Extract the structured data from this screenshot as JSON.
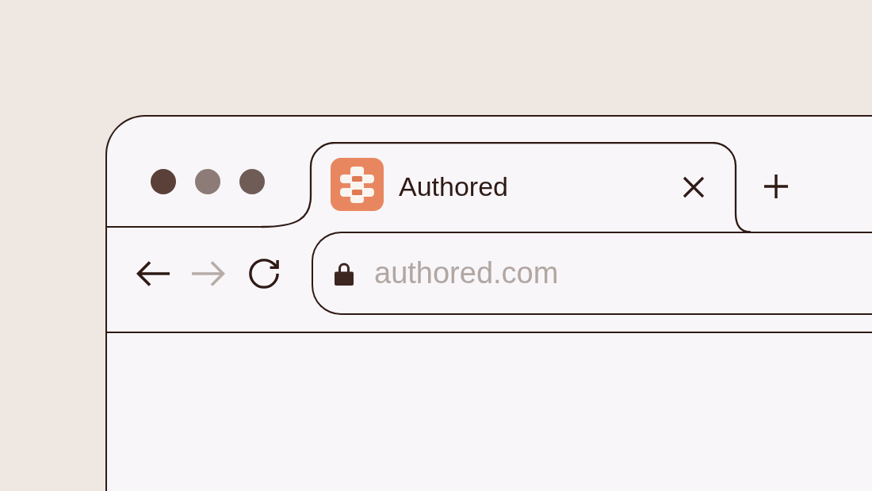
{
  "window_controls": [
    {
      "color": "#5b4039"
    },
    {
      "color": "#8c7b76"
    },
    {
      "color": "#6f5c57"
    }
  ],
  "tabs": [
    {
      "title": "Authored",
      "selected": true
    }
  ],
  "nav_buttons": [
    {
      "kind": "back",
      "disabled": false
    },
    {
      "kind": "forward",
      "disabled": true
    },
    {
      "kind": "reload",
      "disabled": false
    }
  ],
  "address_bar": {
    "url": "authored.com",
    "secure": true
  }
}
